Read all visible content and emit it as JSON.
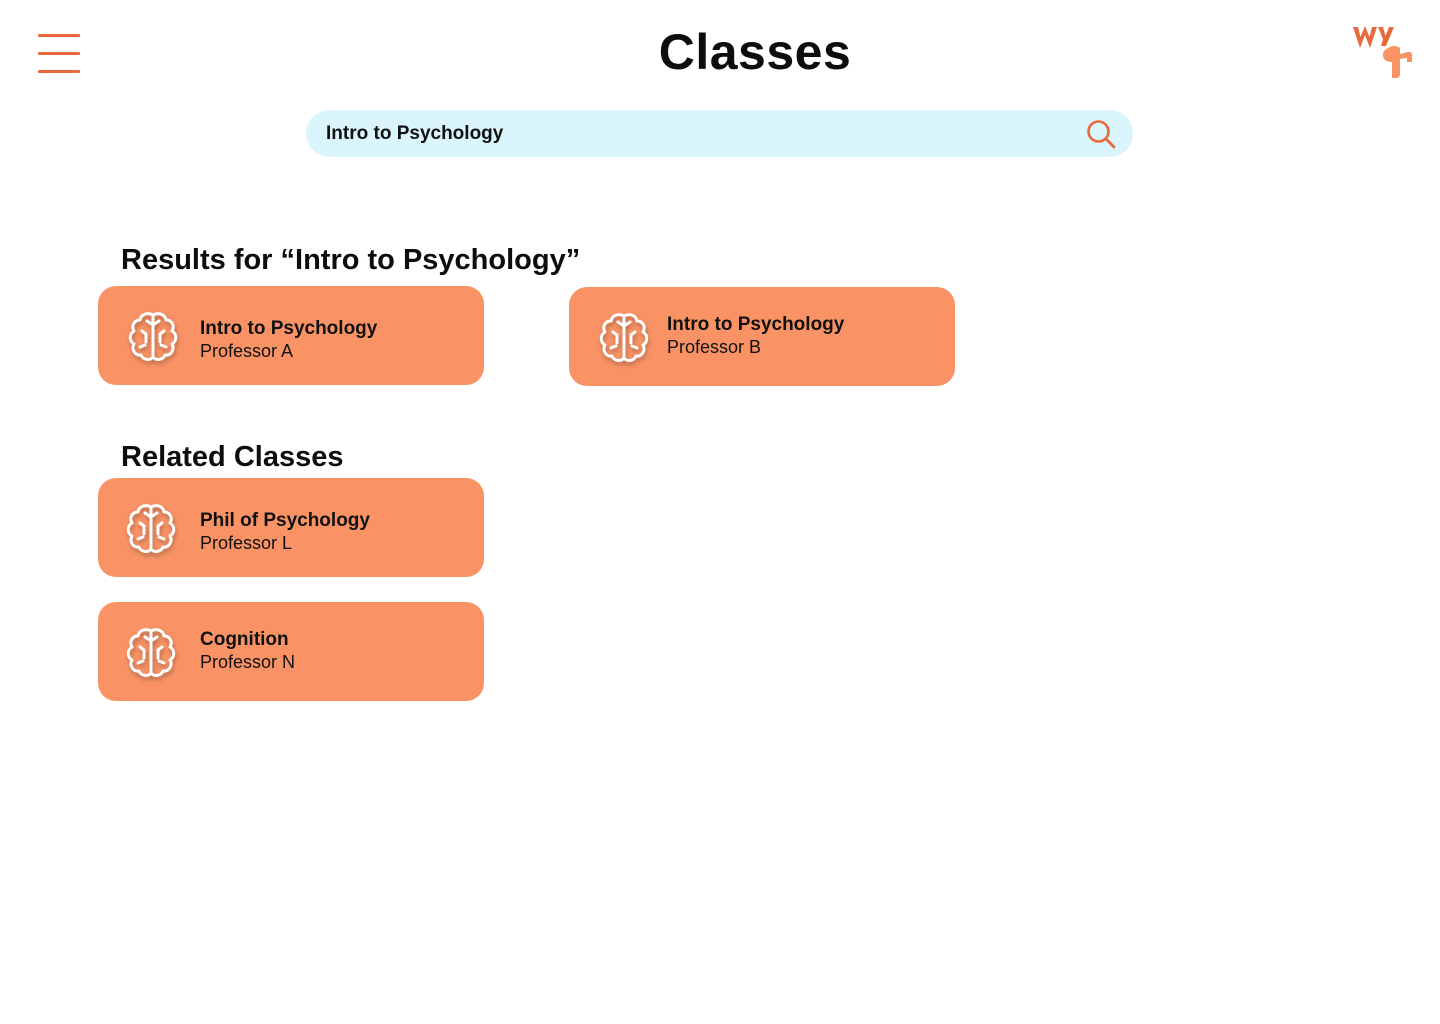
{
  "header": {
    "title": "Classes",
    "menu_icon": "hamburger-menu-icon",
    "logo_icon": "wyt-logo"
  },
  "search": {
    "value": "Intro to Psychology",
    "placeholder": "",
    "icon": "search-icon"
  },
  "results": {
    "heading": "Results for “Intro to Psychology”",
    "items": [
      {
        "title": "Intro to Psychology",
        "professor": "Professor A",
        "icon": "brain-icon"
      },
      {
        "title": "Intro to Psychology",
        "professor": "Professor B",
        "icon": "brain-icon"
      }
    ]
  },
  "related": {
    "heading": "Related Classes",
    "items": [
      {
        "title": "Phil of Psychology",
        "professor": "Professor L",
        "icon": "brain-icon"
      },
      {
        "title": "Cognition",
        "professor": "Professor N",
        "icon": "brain-icon"
      }
    ]
  },
  "colors": {
    "accent": "#e8693d",
    "card_background": "#f99366",
    "search_background": "#dbf5fd",
    "text": "#111111"
  }
}
